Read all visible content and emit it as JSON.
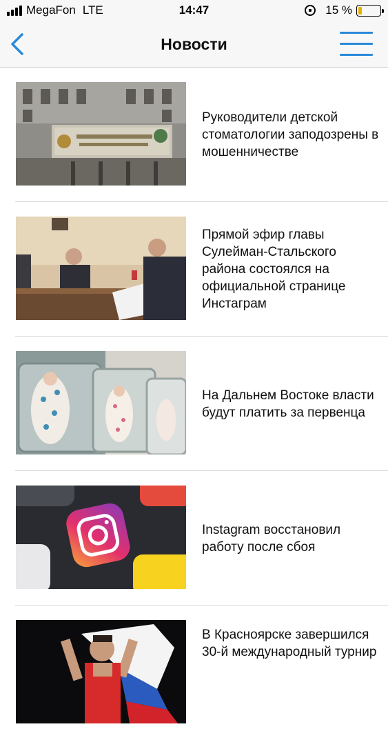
{
  "status_bar": {
    "carrier": "MegaFon",
    "network": "LTE",
    "time": "14:47",
    "battery_percent": "15 %",
    "battery_level": 0.15,
    "battery_color": "#e8b100"
  },
  "nav": {
    "title": "Новости",
    "back_icon": "chevron-left-icon",
    "menu_icon": "hamburger-menu-icon",
    "accent_color": "#2a8ad8"
  },
  "news": [
    {
      "title": "Руководители детской стоматологии заподозрены в мошенничестве",
      "image": "prosecutor-building-photo"
    },
    {
      "title": "Прямой эфир главы Сулейман-Стальского района состоялся на официальной странице Инстаграм",
      "image": "officials-at-desk-photo"
    },
    {
      "title": "На Дальнем Востоке власти будут платить за первенца",
      "image": "newborn-babies-photo"
    },
    {
      "title": "Instagram восстановил работу после сбоя",
      "image": "instagram-app-icon-photo"
    },
    {
      "title": "В Красноярске завершился 30-й международный турнир",
      "image": "wrestler-with-flag-photo"
    }
  ]
}
